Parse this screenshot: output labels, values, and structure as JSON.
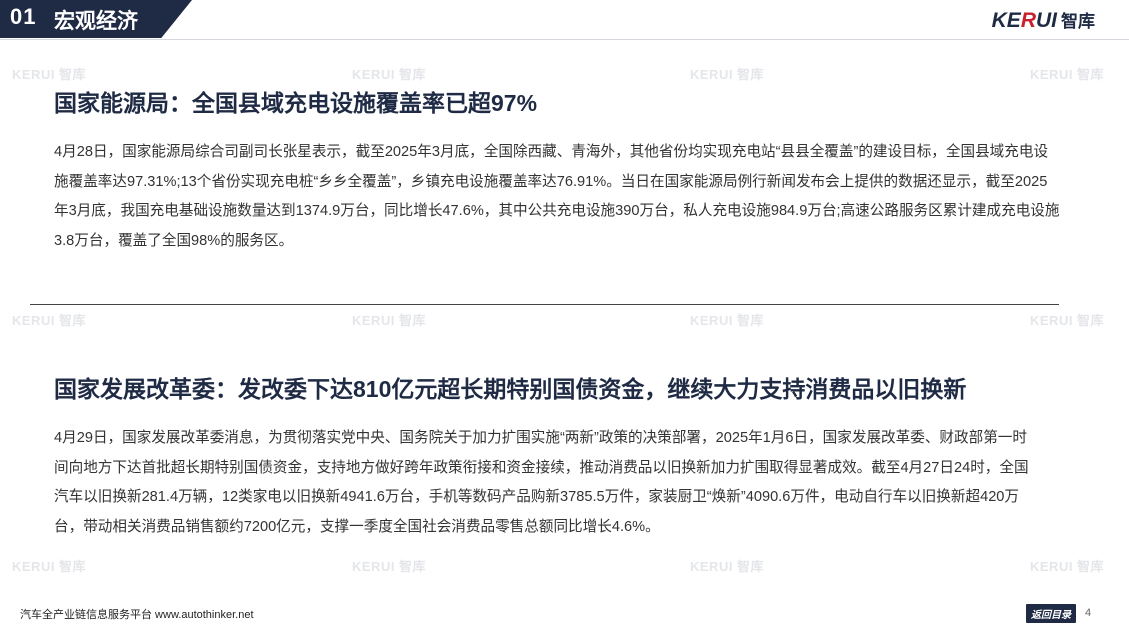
{
  "header": {
    "section_number": "01",
    "section_title": "宏观经济",
    "logo_text_pre": "KE",
    "logo_text_accent": "R",
    "logo_text_post": "UI",
    "logo_cn": "智库"
  },
  "watermark_text": "KERUI 智库",
  "articles": [
    {
      "title": "国家能源局：全国县域充电设施覆盖率已超97%",
      "body": "4月28日，国家能源局综合司副司长张星表示，截至2025年3月底，全国除西藏、青海外，其他省份均实现充电站“县县全覆盖”的建设目标，全国县域充电设施覆盖率达97.31%;13个省份实现充电桩“乡乡全覆盖”，乡镇充电设施覆盖率达76.91%。当日在国家能源局例行新闻发布会上提供的数据还显示，截至2025年3月底，我国充电基础设施数量达到1374.9万台，同比增长47.6%，其中公共充电设施390万台，私人充电设施984.9万台;高速公路服务区累计建成充电设施3.8万台，覆盖了全国98%的服务区。"
    },
    {
      "title": "国家发展改革委：发改委下达810亿元超长期特别国债资金，继续大力支持消费品以旧换新",
      "body": "4月29日，国家发展改革委消息，为贯彻落实党中央、国务院关于加力扩围实施“两新”政策的决策部署，2025年1月6日，国家发展改革委、财政部第一时间向地方下达首批超长期特别国债资金，支持地方做好跨年政策衔接和资金接续，推动消费品以旧换新加力扩围取得显著成效。截至4月27日24时，全国汽车以旧换新281.4万辆，12类家电以旧换新4941.6万台，手机等数码产品购新3785.5万件，家装厨卫“焕新”4090.6万件，电动自行车以旧换新超420万台，带动相关消费品销售额约7200亿元，支撑一季度全国社会消费品零售总额同比增长4.6%。"
    }
  ],
  "footer": {
    "platform_text": "汽车全产业链信息服务平台 www.autothinker.net",
    "back_label": "返回目录",
    "page_number": "4"
  },
  "colors": {
    "navy": "#1f2a44",
    "accent_red": "#c8202d",
    "body_text": "#333333"
  }
}
